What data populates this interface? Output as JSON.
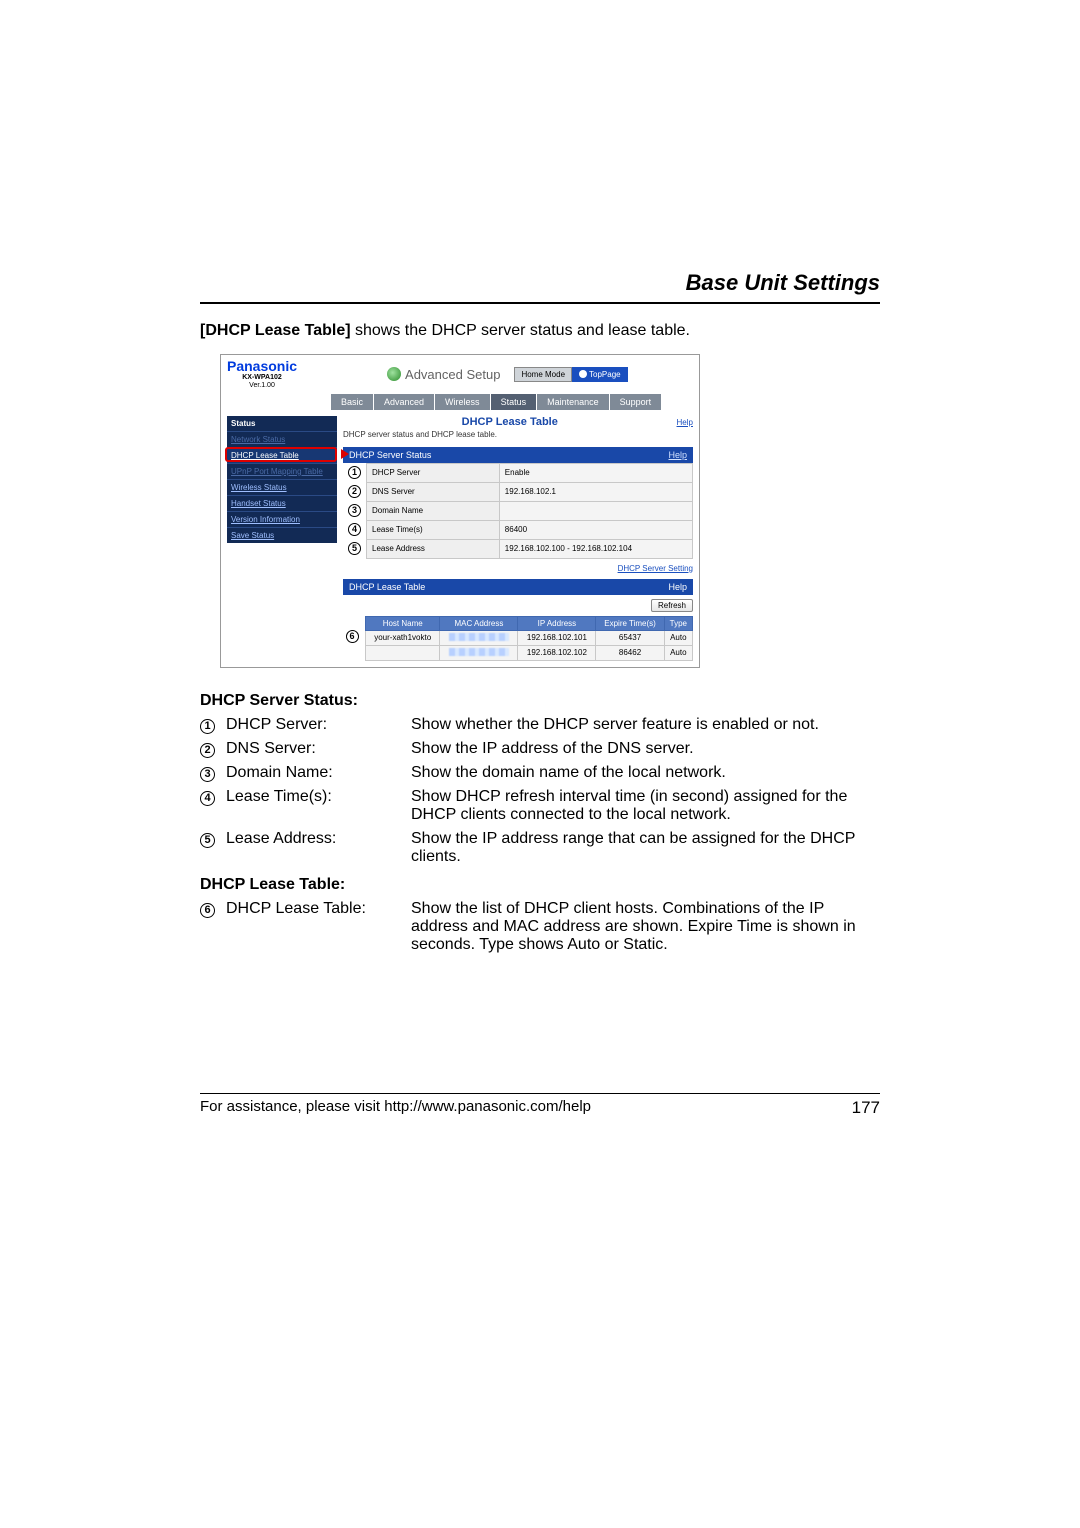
{
  "header": {
    "section_title": "Base Unit Settings"
  },
  "intro": {
    "bold": "[DHCP Lease Table]",
    "rest": " shows the DHCP server status and lease table."
  },
  "shot": {
    "brand": "Panasonic",
    "model": "KX-WPA102",
    "version": "Ver.1.00",
    "setup_label": "Advanced Setup",
    "mode_left": "Home Mode",
    "mode_right": "TopPage",
    "tabs": [
      "Basic",
      "Advanced",
      "Wireless",
      "Status",
      "Maintenance",
      "Support"
    ],
    "active_tab_index": 3,
    "sidebar": {
      "title": "Status",
      "items": [
        {
          "label": "Network Status",
          "dim": true
        },
        {
          "label": "DHCP Lease Table",
          "highlight": true
        },
        {
          "label": "UPnP Port Mapping Table",
          "dim": true
        },
        {
          "label": "Wireless Status"
        },
        {
          "label": "Handset Status"
        },
        {
          "label": "Version Information"
        },
        {
          "label": "Save Status"
        }
      ]
    },
    "panel": {
      "title": "DHCP Lease Table",
      "subtitle": "DHCP server status and DHCP lease table.",
      "help": "Help"
    },
    "server_status": {
      "bar": "DHCP Server Status",
      "help": "Help",
      "rows": [
        {
          "n": "1",
          "label": "DHCP Server",
          "value": "Enable"
        },
        {
          "n": "2",
          "label": "DNS Server",
          "value": "192.168.102.1"
        },
        {
          "n": "3",
          "label": "Domain Name",
          "value": ""
        },
        {
          "n": "4",
          "label": "Lease Time(s)",
          "value": "86400"
        },
        {
          "n": "5",
          "label": "Lease Address",
          "value": "192.168.102.100 - 192.168.102.104"
        }
      ],
      "setting_link": "DHCP Server Setting"
    },
    "lease_table": {
      "bar": "DHCP Lease Table",
      "help": "Help",
      "refresh": "Refresh",
      "num": "6",
      "headers": [
        "Host Name",
        "MAC Address",
        "IP Address",
        "Expire Time(s)",
        "Type"
      ],
      "rows": [
        {
          "host": "your-xath1vokto",
          "ip": "192.168.102.101",
          "expire": "65437",
          "type": "Auto"
        },
        {
          "host": "",
          "ip": "192.168.102.102",
          "expire": "86462",
          "type": "Auto"
        }
      ]
    }
  },
  "desc": {
    "status_heading": "DHCP Server Status:",
    "items_status": [
      {
        "n": "1",
        "label": "DHCP Server:",
        "text": "Show whether the DHCP server feature is enabled or not."
      },
      {
        "n": "2",
        "label": "DNS Server:",
        "text": "Show the IP address of the DNS server."
      },
      {
        "n": "3",
        "label": "Domain Name:",
        "text": "Show the domain name of the local network."
      },
      {
        "n": "4",
        "label": "Lease Time(s):",
        "text": "Show DHCP refresh interval time (in second) assigned for the DHCP clients connected to the local network."
      },
      {
        "n": "5",
        "label": "Lease Address:",
        "text": "Show the IP address range that can be assigned for the DHCP clients."
      }
    ],
    "lease_heading": "DHCP Lease Table:",
    "items_lease": [
      {
        "n": "6",
        "label": "DHCP Lease Table:",
        "text": "Show the list of DHCP client hosts. Combinations of the IP address and MAC address are shown. Expire Time is shown in seconds. Type shows Auto or Static."
      }
    ]
  },
  "footer": {
    "assist": "For assistance, please visit http://www.panasonic.com/help",
    "page": "177"
  }
}
